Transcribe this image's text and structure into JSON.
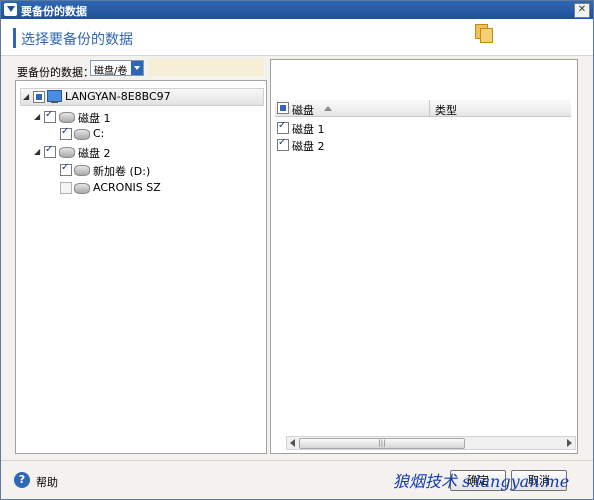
{
  "window": {
    "title": "要备份的数据"
  },
  "header": {
    "heading": "选择要备份的数据"
  },
  "data_source": {
    "label": "要备份的数据：",
    "selected": "磁盘/卷"
  },
  "tree": {
    "root": "LANGYAN-8E8BC97",
    "disk1": "磁盘 1",
    "disk1_vol": "C:",
    "disk2": "磁盘 2",
    "disk2_vol": "新加卷 (D:)",
    "disk2_zone": "ACRONIS SZ"
  },
  "table": {
    "columns": [
      "磁盘",
      "类型"
    ],
    "rows": [
      {
        "name": "磁盘 1",
        "checked": true
      },
      {
        "name": "磁盘 2",
        "checked": true
      }
    ]
  },
  "footer": {
    "help": "帮助",
    "ok": "确定",
    "cancel": "取消",
    "watermark": "狼烟技术 s.langyan.me"
  },
  "icons": [
    "app-icon",
    "close-icon",
    "computer-icon",
    "disk-icon",
    "help-icon",
    "sort-ascending-icon"
  ],
  "colors": {
    "accent": "#2f67b4",
    "titlebar": "#1f4f98",
    "watermark": "#103cb0"
  }
}
